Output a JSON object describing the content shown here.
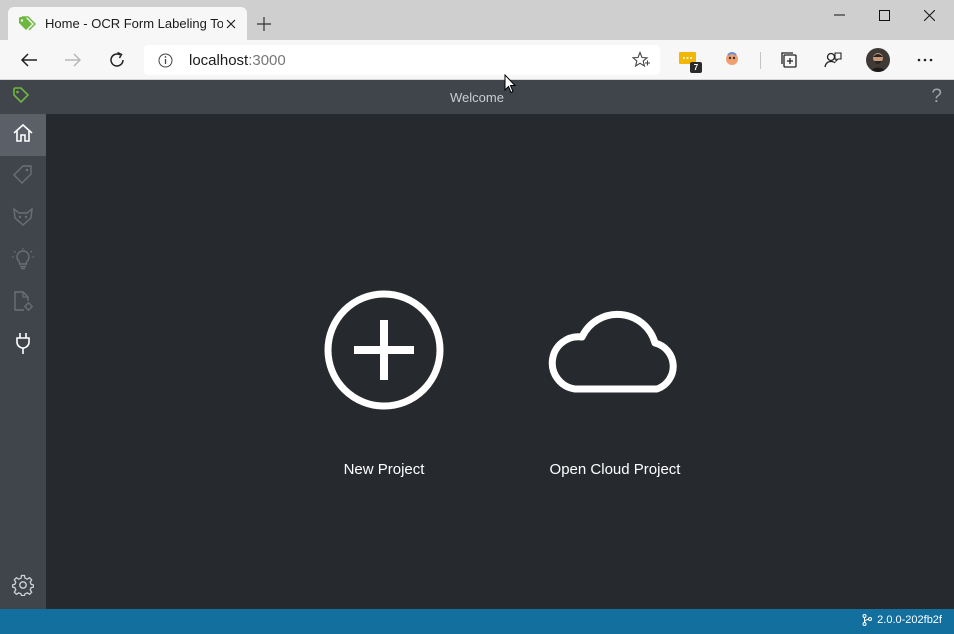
{
  "browser": {
    "tab": {
      "title": "Home - OCR Form Labeling Tool",
      "favicon": "tag-icon"
    },
    "address": {
      "host": "localhost",
      "port": ":3000"
    },
    "extension_badge": "7"
  },
  "app": {
    "title": "Welcome",
    "help": "?",
    "sidebar": [
      {
        "icon": "home-icon",
        "active": true
      },
      {
        "icon": "tag-icon",
        "active": false
      },
      {
        "icon": "fox-icon",
        "active": false
      },
      {
        "icon": "lightbulb-icon",
        "active": false
      },
      {
        "icon": "document-settings-icon",
        "active": false
      },
      {
        "icon": "plug-icon",
        "active": false
      }
    ],
    "settings_icon": "gear-icon",
    "actions": {
      "new_project": "New Project",
      "open_cloud_project": "Open Cloud Project"
    },
    "version": "2.0.0-202fb2f"
  },
  "colors": {
    "accent_green": "#6fb83f",
    "app_bar": "#40454c",
    "main_bg": "#26292e",
    "status_blue": "#136f9e"
  }
}
